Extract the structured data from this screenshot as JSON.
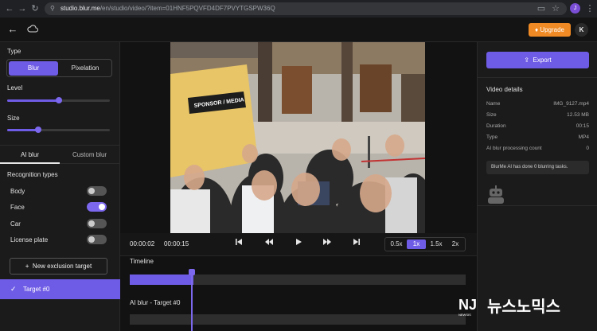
{
  "browser": {
    "url_host": "studio.blur.me",
    "url_path": "/en/studio/video/?item=01HNF5PQVFD4DF7PVYTGSPW36Q",
    "profile_initial": "J"
  },
  "header": {
    "upgrade_label": "Upgrade",
    "user_initial": "K"
  },
  "left": {
    "type_label": "Type",
    "type_options": [
      "Blur",
      "Pixelation"
    ],
    "type_selected": "Blur",
    "level_label": "Level",
    "level_value": 0.5,
    "size_label": "Size",
    "size_value": 0.3,
    "tabs": [
      "AI blur",
      "Custom blur"
    ],
    "active_tab": "AI blur",
    "recognition_title": "Recognition types",
    "recognition": [
      {
        "label": "Body",
        "on": false
      },
      {
        "label": "Face",
        "on": true
      },
      {
        "label": "Car",
        "on": false
      },
      {
        "label": "License plate",
        "on": false
      }
    ],
    "new_exclusion_label": "New exclusion target",
    "target_label": "Target #0"
  },
  "video": {
    "sign_text": "SPONSOR / MEDIA"
  },
  "player": {
    "current_time": "00:00:02",
    "total_time": "00:00:15",
    "speeds": [
      "0.5x",
      "1x",
      "1.5x",
      "2x"
    ],
    "speed_selected": "1x",
    "timeline_label": "Timeline",
    "ai_track_label": "AI blur - Target #0",
    "progress": 0.19
  },
  "right": {
    "export_label": "Export",
    "details_title": "Video details",
    "details": [
      {
        "k": "Name",
        "v": "IMG_9127.mp4"
      },
      {
        "k": "Size",
        "v": "12.53 MB"
      },
      {
        "k": "Duration",
        "v": "00:15"
      },
      {
        "k": "Type",
        "v": "MP4"
      },
      {
        "k": "AI blur processing count",
        "v": "0"
      }
    ],
    "note": "BlurMe AI has done 0 blurring tasks."
  },
  "watermark": {
    "logo_text": "NJ",
    "logo_sub": "NEWSIS",
    "brand_text": "뉴스노믹스"
  },
  "colors": {
    "accent": "#6f5ce6",
    "upgrade": "#f08a24",
    "bg": "#141414"
  }
}
